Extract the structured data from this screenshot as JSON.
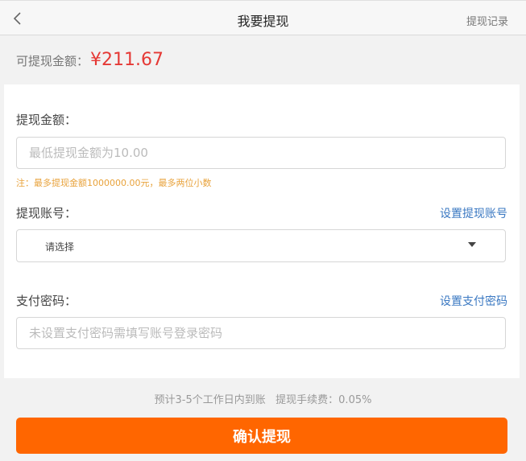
{
  "header": {
    "title": "我要提现",
    "records_label": "提现记录"
  },
  "balance": {
    "label": "可提现金额：",
    "amount": "¥211.67"
  },
  "form": {
    "amount_label": "提现金额：",
    "amount_placeholder": "最低提现金额为10.00",
    "amount_note": "注：最多提现金额1000000.00元，最多两位小数",
    "account_label": "提现账号：",
    "account_link": "设置提现账号",
    "account_select_value": "请选择",
    "password_label": "支付密码：",
    "password_link": "设置支付密码",
    "password_placeholder": "未设置支付密码需填写账号登录密码"
  },
  "footer": {
    "tip": "预计3-5个工作日内到账   提现手续费：0.05%",
    "submit_label": "确认提现"
  },
  "colors": {
    "accent": "#ff6600",
    "amount": "#e53935",
    "link": "#3a78c2",
    "note": "#e8a23b"
  },
  "icons": {
    "back": "chevron-left-icon",
    "select_caret": "caret-down-icon"
  }
}
